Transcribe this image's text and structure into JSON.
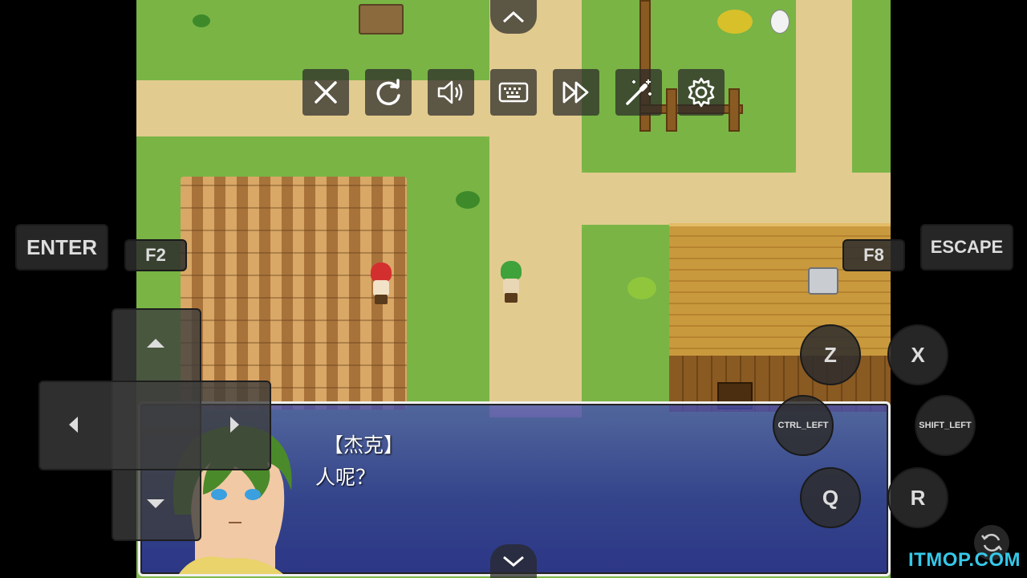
{
  "toolbar": {
    "close_icon": "close-icon",
    "restart_icon": "restart-icon",
    "volume_icon": "volume-icon",
    "keyboard_icon": "keyboard-icon",
    "fast_forward_icon": "fast-forward-icon",
    "cheat_icon": "magic-wand-icon",
    "settings_icon": "gear-icon",
    "expand_up_icon": "chevron-up-icon",
    "collapse_down_icon": "chevron-down-icon"
  },
  "keys": {
    "enter": "ENTER",
    "f2": "F2",
    "f8": "F8",
    "escape": "ESCAPE",
    "z": "Z",
    "x": "X",
    "ctrl_left": "CTRL_LEFT",
    "shift_left": "SHIFT_LEFT",
    "q": "Q",
    "r": "R"
  },
  "dialog": {
    "speaker": "【杰克】",
    "text": "人呢？"
  },
  "watermark": "ITMOP.COM",
  "colors": {
    "grass": "#79b445",
    "path": "#e2cb8f",
    "dialog_blue": "#2f3a9a",
    "watermark": "#35c8e8"
  }
}
